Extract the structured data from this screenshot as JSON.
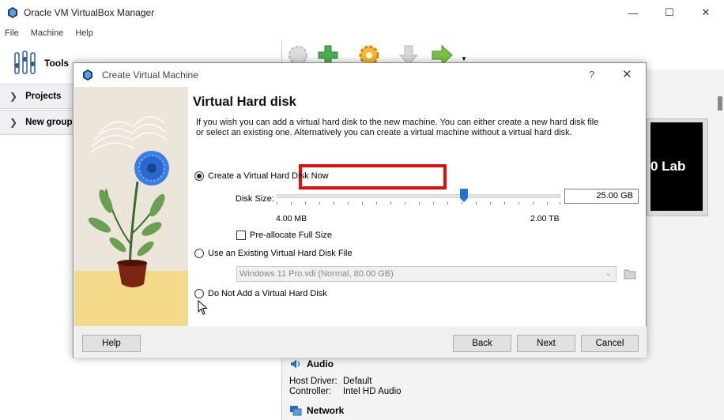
{
  "main_window": {
    "title": "Oracle VM VirtualBox Manager",
    "controls": {
      "minimize": "—",
      "maximize": "☐",
      "close": "✕"
    }
  },
  "menubar": {
    "items": [
      "File",
      "Machine",
      "Help"
    ]
  },
  "sidebar": {
    "tools_label": "Tools",
    "groups": [
      {
        "label": "Projects"
      },
      {
        "label": "New group"
      }
    ]
  },
  "preview": {
    "text": "0 Lab"
  },
  "details": {
    "audio": {
      "title": "Audio",
      "host_driver_key": "Host Driver:",
      "host_driver_val": "Default",
      "controller_key": "Controller:",
      "controller_val": "Intel HD Audio"
    },
    "network": {
      "title": "Network"
    }
  },
  "dialog": {
    "title": "Create Virtual Machine",
    "help_glyph": "?",
    "close_glyph": "✕",
    "heading": "Virtual Hard disk",
    "description": "If you wish you can add a virtual hard disk to the new machine. You can either create a new hard disk file or select an existing one. Alternatively you can create a virtual machine without a virtual hard disk.",
    "options": {
      "create_now": "Create a Virtual Hard Disk Now",
      "use_existing": "Use an Existing Virtual Hard Disk File",
      "do_not_add": "Do Not Add a Virtual Hard Disk"
    },
    "selected_option": "create_now",
    "disk_size_label": "Disk Size:",
    "disk_size_value": "25.00 GB",
    "slider_min_label": "4.00 MB",
    "slider_max_label": "2.00 TB",
    "slider_position_fraction": 0.66,
    "preallocate_label": "Pre-allocate Full Size",
    "preallocate_checked": false,
    "existing_disk_value": "Windows 11 Pro.vdi (Normal, 80.00 GB)",
    "buttons": {
      "help": "Help",
      "back": "Back",
      "next": "Next",
      "cancel": "Cancel"
    }
  },
  "colors": {
    "highlight": "#e10e0e",
    "slider_thumb": "#1976d2",
    "accent_green": "#4caf50"
  }
}
